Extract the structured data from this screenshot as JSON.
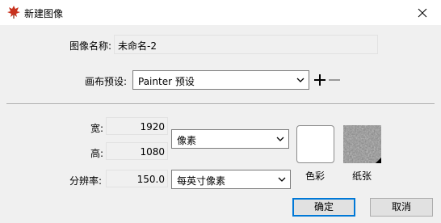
{
  "window": {
    "title": "新建图像"
  },
  "icons": {
    "app": "maple-leaf-icon",
    "close": "close-icon",
    "add": "plus-icon",
    "remove": "minus-icon",
    "dropdown": "chevron-down-icon"
  },
  "form": {
    "name_label": "图像名称:",
    "name_value": "未命名-2",
    "preset_label": "画布预设:",
    "preset_value": "Painter 预设",
    "width_label": "宽:",
    "width_value": "1920",
    "height_label": "高:",
    "height_value": "1080",
    "units_value": "像素",
    "resolution_label": "分辨率:",
    "resolution_value": "150.0",
    "resolution_units_value": "每英寸像素",
    "color_label": "色彩",
    "paper_label": "纸张"
  },
  "buttons": {
    "ok": "确定",
    "cancel": "取消"
  },
  "colors": {
    "canvas_color": "#ffffff",
    "accent": "#0078d7",
    "app_icon": "#c8321e"
  }
}
